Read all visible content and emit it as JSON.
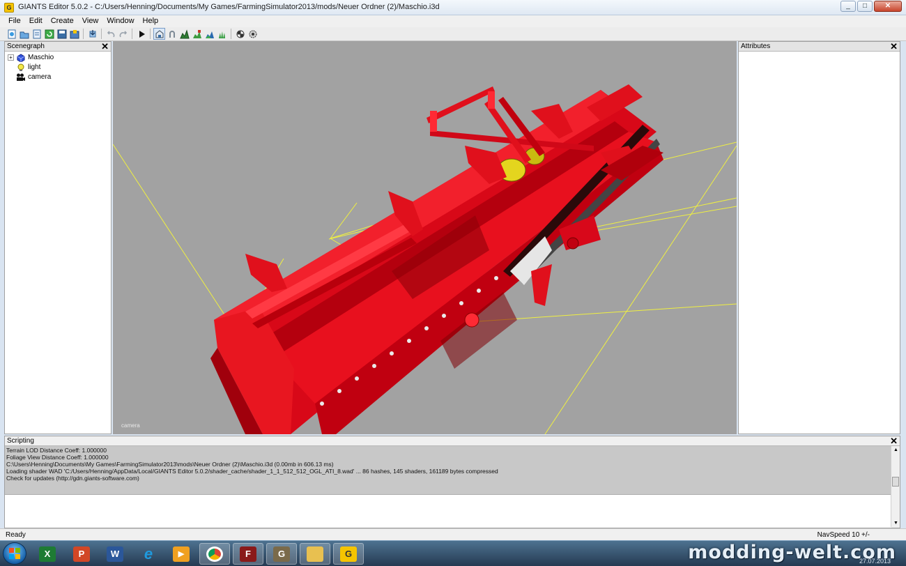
{
  "window": {
    "title": "GIANTS Editor 5.0.2 - C:/Users/Henning/Documents/My Games/FarmingSimulator2013/mods/Neuer Ordner (2)/Maschio.i3d",
    "minimize": "_",
    "maximize": "□",
    "close": "✕"
  },
  "menu": [
    "File",
    "Edit",
    "Create",
    "View",
    "Window",
    "Help"
  ],
  "toolbar": {
    "icons": [
      "new-icon",
      "open-icon",
      "save-as-icon",
      "reload-icon",
      "save-icon",
      "export-icon",
      "import-icon",
      "undo-icon",
      "redo-icon",
      "play-icon",
      "select-mode-icon",
      "move-mode-icon",
      "terrain-sculpt-icon",
      "terrain-paint-icon",
      "foliage-paint-icon",
      "grass-paint-icon",
      "grid-icon",
      "settings-icon"
    ]
  },
  "scenegraph": {
    "title": "Scenegraph",
    "close": "✕",
    "expander": "+",
    "nodes": [
      {
        "label": "Maschio",
        "icon": "transform-group-icon"
      },
      {
        "label": "light",
        "icon": "light-bulb-icon"
      },
      {
        "label": "camera",
        "icon": "camera-icon"
      }
    ]
  },
  "viewport": {
    "camera_label": "camera",
    "background": "#a2a2a2",
    "model_color": "#e0101c",
    "gizmo_color": "#f0f040"
  },
  "attributes": {
    "title": "Attributes",
    "close": "✕"
  },
  "scripting": {
    "title": "Scripting",
    "close": "✕",
    "log": [
      "  Terrain LOD Distance Coeff: 1.000000",
      "  Foliage View Distance Coeff: 1.000000",
      "C:\\Users\\Henning\\Documents\\My Games\\FarmingSimulator2013\\mods\\Neuer Ordner (2)\\Maschio.i3d (0.00mb in 606.13 ms)",
      "Loading shader WAD 'C:/Users/Henning/AppData/Local/GIANTS Editor 5.0.2/shader_cache/shader_1_1_512_512_OGL_ATI_8.wad' ... 86 hashes, 145 shaders, 161189 bytes compressed",
      "Check for updates (http://gdn.giants-software.com)"
    ]
  },
  "status": {
    "left": "Ready",
    "right": "NavSpeed 10 +/-"
  },
  "taskbar": {
    "apps": [
      "excel-icon",
      "powerpoint-icon",
      "word-icon",
      "internet-explorer-icon",
      "media-player-icon",
      "chrome-icon",
      "farming-simulator-icon",
      "gimp-icon",
      "file-explorer-icon",
      "giants-editor-icon"
    ],
    "watermark": "modding-welt.com",
    "date": "27.07.2013"
  }
}
